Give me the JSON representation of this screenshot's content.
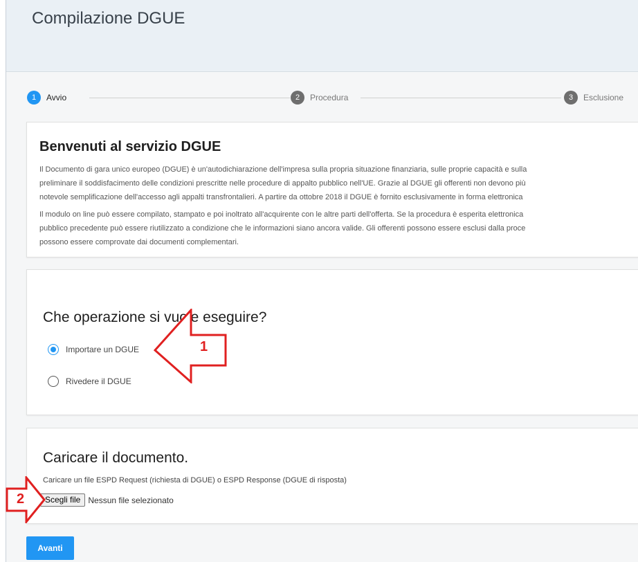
{
  "header": {
    "title": "Compilazione DGUE"
  },
  "stepper": {
    "steps": [
      {
        "number": "1",
        "label": "Avvio",
        "state": "active"
      },
      {
        "number": "2",
        "label": "Procedura",
        "state": "todo"
      },
      {
        "number": "3",
        "label": "Esclusione",
        "state": "todo"
      }
    ]
  },
  "welcome": {
    "title": "Benvenuti al servizio DGUE",
    "paragraph1": [
      "Il Documento di gara unico europeo (DGUE) è un'autodichiarazione dell'impresa sulla propria situazione finanziaria, sulle proprie capacità e sulla",
      "preliminare il soddisfacimento delle condizioni prescritte nelle procedure di appalto pubblico nell'UE. Grazie al DGUE gli offerenti non devono più",
      "notevole semplificazione dell'accesso agli appalti transfrontalieri. A partire da ottobre 2018 il DGUE è fornito esclusivamente in forma elettronica"
    ],
    "paragraph2": [
      "Il modulo on line può essere compilato, stampato e poi inoltrato all'acquirente con le altre parti dell'offerta. Se la procedura è esperita elettronica",
      "pubblico precedente può essere riutilizzato a condizione che le informazioni siano ancora valide. Gli offerenti possono essere esclusi dalla proce",
      "possono essere comprovate dai documenti complementari."
    ]
  },
  "operation": {
    "title": "Che operazione si vuole eseguire?",
    "options": [
      {
        "label": "Importare un DGUE",
        "checked": true
      },
      {
        "label": "Rivedere il DGUE",
        "checked": false
      }
    ]
  },
  "upload": {
    "title": "Caricare il documento.",
    "hint": "Caricare un file ESPD Request (richiesta di DGUE) o ESPD Response (DGUE di risposta)",
    "button_label": "Scegli file",
    "status": "Nessun file selezionato"
  },
  "next_button": "Avanti",
  "annotations": {
    "marker1": "1",
    "marker2": "2",
    "color": "#e02020"
  },
  "colors": {
    "accent": "#2196f3",
    "header_bg": "#eaf0f5",
    "step_inactive": "#6e6e6e"
  }
}
